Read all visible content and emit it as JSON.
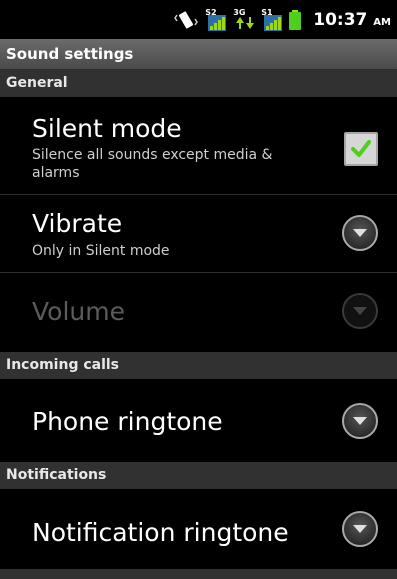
{
  "status_bar": {
    "signals": [
      {
        "label": "S2",
        "icon": "signal-s2-icon"
      },
      {
        "label": "3G",
        "icon": "data-3g-icon"
      },
      {
        "label": "S1",
        "icon": "signal-s1-icon"
      }
    ],
    "time": "10:37",
    "ampm": "AM"
  },
  "title": "Sound settings",
  "sections": {
    "general": "General",
    "incoming_calls": "Incoming calls",
    "notifications": "Notifications"
  },
  "items": {
    "silent_mode": {
      "title": "Silent mode",
      "summary": "Silence all sounds except media & alarms",
      "checked": true
    },
    "vibrate": {
      "title": "Vibrate",
      "summary": "Only in Silent mode"
    },
    "volume": {
      "title": "Volume"
    },
    "phone_ringtone": {
      "title": "Phone ringtone"
    },
    "notification_ringtone": {
      "title": "Notification ringtone"
    }
  },
  "colors": {
    "check_green": "#4fce1d",
    "category_bg": "#313131",
    "title_bar_bg": "#5a5a5a",
    "disabled_text": "#5c5c5c"
  }
}
